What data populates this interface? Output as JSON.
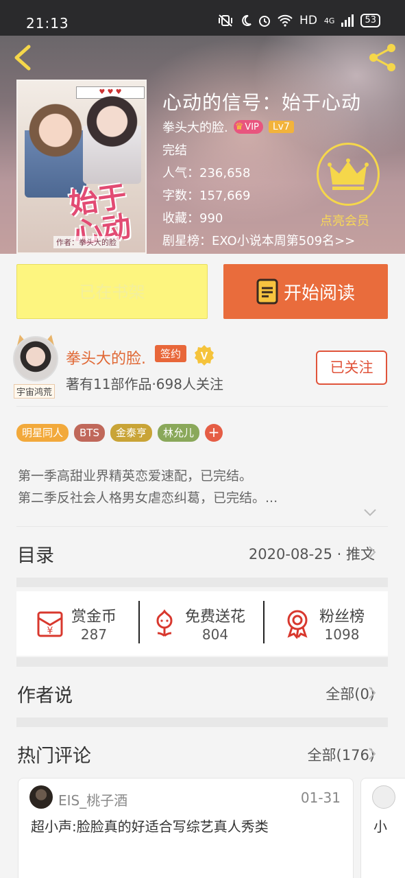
{
  "status_bar": {
    "time": "21:13",
    "network": "HD",
    "signal_type": "4G",
    "battery": "53"
  },
  "book": {
    "title": "心动的信号：始于心动",
    "author": "拳头大的脸.",
    "vip_label": "VIP",
    "level": "Lv7",
    "status": "完结",
    "popularity": "人气：236,658",
    "word_count": "字数：157,669",
    "favorites": "收藏：990",
    "ranking": "剧星榜：EXO小说本周第509名>>",
    "cover_title": "始于心动",
    "cover_author": "作者：拳头大的脸"
  },
  "vip_member": {
    "label": "点亮会员"
  },
  "actions": {
    "shelf_label": "已在书架",
    "read_label": "开始阅读"
  },
  "author_panel": {
    "name": "拳头大的脸.",
    "sign_badge": "签约",
    "v_badge": "V",
    "stats": "著有11部作品·698人关注",
    "follow_label": "已关注",
    "avatar_tag": "宇宙鸿荒"
  },
  "tags": [
    {
      "label": "明星同人",
      "color": "#f2a93b"
    },
    {
      "label": "BTS",
      "color": "#c0685a"
    },
    {
      "label": "金泰亨",
      "color": "#c9a437"
    },
    {
      "label": "林允儿",
      "color": "#8aa85a"
    }
  ],
  "tag_add_label": "+",
  "intro": {
    "line1": "第一季高甜业界精英恋爱速配，已完结。",
    "line2": "第二季反社会人格男女虐恋纠葛，已完结。..."
  },
  "toc": {
    "title": "目录",
    "right": "2020-08-25 · 推文"
  },
  "rewards": [
    {
      "label": "赏金币",
      "value": "287",
      "icon": "red-envelope-icon"
    },
    {
      "label": "免费送花",
      "value": "804",
      "icon": "flower-icon"
    },
    {
      "label": "粉丝榜",
      "value": "1098",
      "icon": "medal-icon"
    }
  ],
  "author_says": {
    "title": "作者说",
    "right": "全部(0)"
  },
  "hot_comments": {
    "title": "热门评论",
    "right": "全部(176)",
    "items": [
      {
        "user": "EIS_桃子酒",
        "date": "01-31",
        "text": "超小声:脸脸真的好适合写综艺真人秀类"
      },
      {
        "user": "",
        "date": "",
        "text": "小"
      }
    ]
  },
  "colors": {
    "accent_orange": "#e96c3c",
    "shelf_yellow": "#fdf57f",
    "gold": "#f5d74a"
  }
}
